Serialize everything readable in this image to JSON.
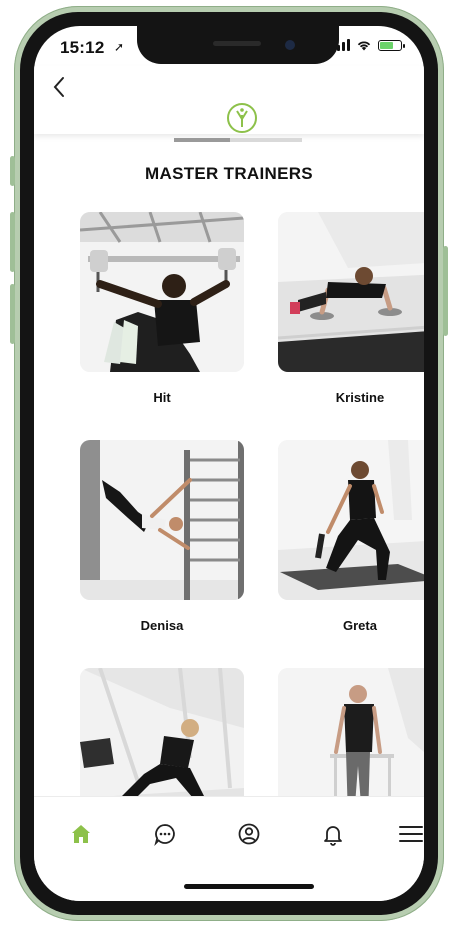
{
  "status": {
    "time": "15:12"
  },
  "header": {
    "title": "MASTER TRAINERS"
  },
  "trainers": [
    {
      "name": "Hit"
    },
    {
      "name": "Kristine"
    },
    {
      "name": "Denisa"
    },
    {
      "name": "Greta"
    },
    {
      "name": ""
    },
    {
      "name": ""
    }
  ],
  "tabs": [
    {
      "icon": "home-icon",
      "active": true
    },
    {
      "icon": "chat-icon"
    },
    {
      "icon": "profile-icon"
    },
    {
      "icon": "bell-icon"
    },
    {
      "icon": "menu-icon"
    }
  ],
  "colors": {
    "accent": "#8dc14a",
    "device": "#b7cdb0"
  }
}
